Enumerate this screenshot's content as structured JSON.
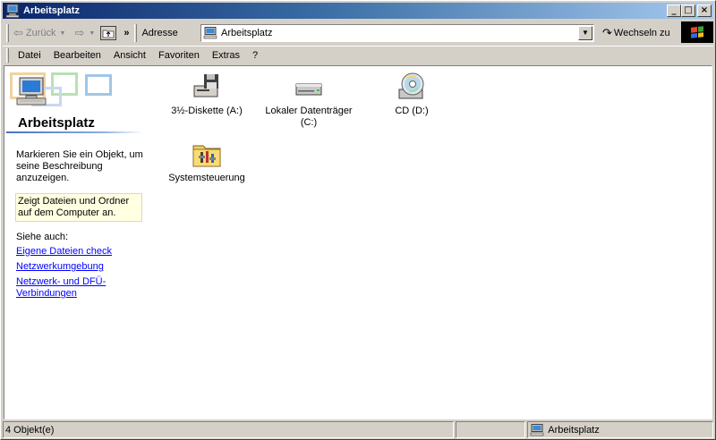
{
  "window": {
    "title": "Arbeitsplatz",
    "buttons": {
      "minimize": "_",
      "maximize": "□",
      "close": "×"
    }
  },
  "toolbar": {
    "back_label": "Zurück",
    "more": "»",
    "address_label": "Adresse",
    "address_value": "Arbeitsplatz",
    "go_label": "Wechseln zu"
  },
  "menu": [
    "Datei",
    "Bearbeiten",
    "Ansicht",
    "Favoriten",
    "Extras",
    "?"
  ],
  "leftpane": {
    "title": "Arbeitsplatz",
    "description": "Markieren Sie ein Objekt, um seine Beschreibung anzuzeigen.",
    "info": "Zeigt Dateien und Ordner auf dem Computer an.",
    "see_also": "Siehe auch:",
    "links": [
      "Eigene Dateien check",
      "Netzwerkumgebung",
      "Netzwerk- und DFÜ-Verbindungen"
    ]
  },
  "items": [
    {
      "label": "3½-Diskette (A:)",
      "icon": "floppy-drive-icon"
    },
    {
      "label": "Lokaler Datenträger (C:)",
      "icon": "hard-drive-icon"
    },
    {
      "label": "CD (D:)",
      "icon": "cd-drive-icon"
    },
    {
      "label": "Systemsteuerung",
      "icon": "control-panel-icon"
    }
  ],
  "status": {
    "count": "4 Objekt(e)",
    "location": "Arbeitsplatz"
  },
  "colors": {
    "titlebar_start": "#0a246a",
    "titlebar_end": "#a6caf0",
    "link": "#0000ff",
    "info_bg": "#ffffe1",
    "chrome": "#d4d0c8"
  }
}
